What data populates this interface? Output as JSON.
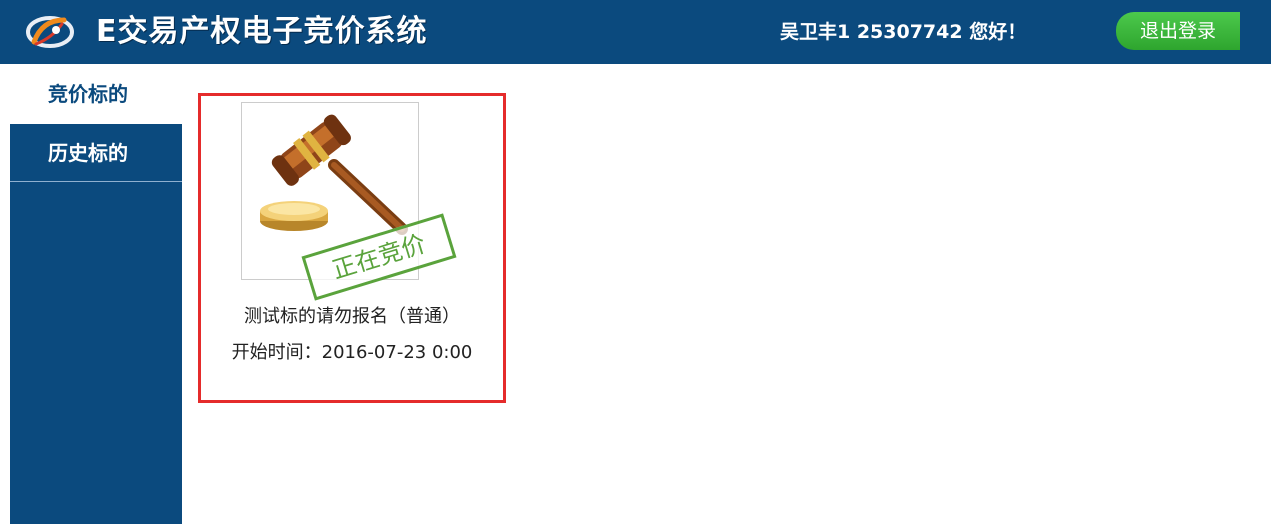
{
  "header": {
    "title": "E交易产权电子竞价系统",
    "greeting": "吴卫丰1 25307742 您好！",
    "logout_label": "退出登录",
    "background_color": "#0b4a7e"
  },
  "sidebar": {
    "items": [
      {
        "label": "竞价标的",
        "active": true
      },
      {
        "label": "历史标的",
        "active": false
      }
    ]
  },
  "listing": {
    "items": [
      {
        "title": "测试标的请勿报名（普通）",
        "start_time": "开始时间：2016-07-23 0:00",
        "status_stamp": "正在竞价",
        "image": "auction-gavel-icon",
        "highlight_color": "#e52b2b"
      }
    ]
  }
}
